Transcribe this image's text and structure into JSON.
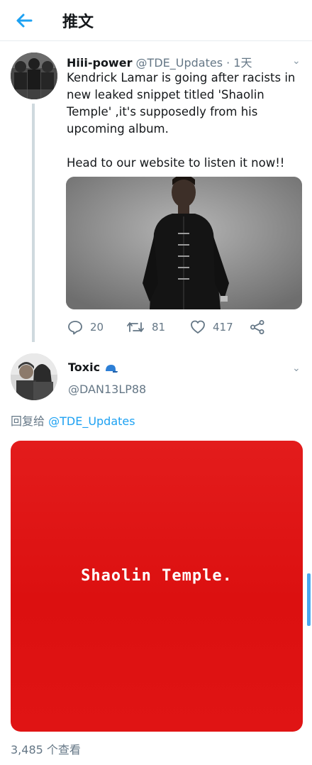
{
  "header": {
    "title": "推文"
  },
  "tweet": {
    "name": "Hiii-power",
    "handle": "@TDE_Updates · 1天",
    "text": "Kendrick Lamar is going after racists in new leaked snippet titled 'Shaolin Temple' ,it's supposedly from his upcoming album.\n\nHead to our website to listen it now!!",
    "replies": "20",
    "retweets": "81",
    "likes": "417"
  },
  "reply": {
    "name": "Toxic",
    "handle": "@DAN13LP88",
    "reply_prefix": "回复给",
    "reply_mention": "@TDE_Updates",
    "card_text": "Shaolin Temple.",
    "views": "3,485 个查看"
  },
  "colors": {
    "accent": "#1da1f2",
    "card_red": "#e01414",
    "muted": "#657786"
  }
}
